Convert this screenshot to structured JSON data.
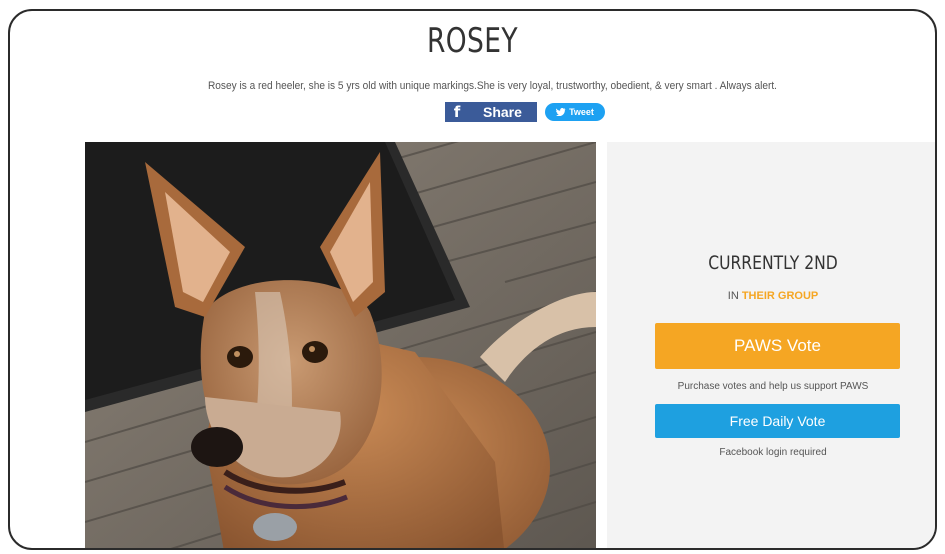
{
  "profile": {
    "name": "ROSEY",
    "description": "Rosey is a red heeler, she is 5 yrs old with unique markings.She is very loyal, trustworthy, obedient, & very smart . Always alert."
  },
  "social": {
    "share_label": "Share",
    "share_icon": "f",
    "tweet_label": "Tweet"
  },
  "standing": {
    "rank_text": "CURRENTLY 2ND",
    "group_prefix": "IN",
    "group_highlight": "THEIR GROUP"
  },
  "actions": {
    "paws_vote_label": "PAWS Vote",
    "paws_vote_note": "Purchase votes and help us support PAWS",
    "free_vote_label": "Free Daily Vote",
    "free_vote_note": "Facebook login required"
  },
  "colors": {
    "accent_orange": "#f5a623",
    "accent_blue": "#1ea0e0",
    "facebook_blue": "#3b5b99",
    "twitter_blue": "#1da1f2"
  }
}
